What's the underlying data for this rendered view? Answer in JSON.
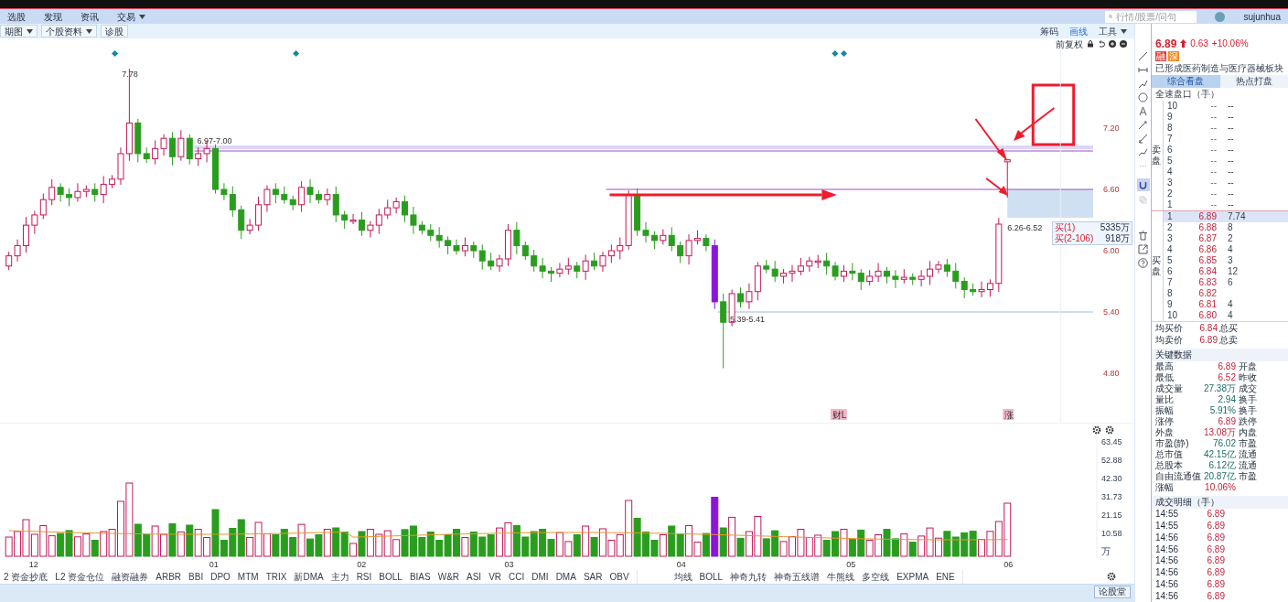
{
  "menu": [
    {
      "label": "选股",
      "dropdown": false
    },
    {
      "label": "发现",
      "dropdown": false
    },
    {
      "label": "资讯",
      "dropdown": false
    },
    {
      "label": "交易",
      "dropdown": true
    }
  ],
  "search": {
    "placeholder": "行情/股票/问句"
  },
  "user": "sujunhua",
  "toolbar_left": [
    {
      "label": "期图",
      "dropdown": true
    },
    {
      "label": "个股资料",
      "dropdown": true
    },
    {
      "label": "诊股",
      "dropdown": false
    }
  ],
  "toolbar_right": [
    {
      "label": "筹码",
      "selected": false,
      "dropdown": false
    },
    {
      "label": "画线",
      "selected": true,
      "dropdown": false
    },
    {
      "label": "工具",
      "selected": false,
      "dropdown": true
    }
  ],
  "adjust": "前复权",
  "chart": {
    "labels": [
      "7.78",
      "6.97-7.00",
      "6.26-6.52",
      "5.39-5.41"
    ],
    "price_ticks": [
      "7.20",
      "6.60",
      "6.00",
      "5.40",
      "4.80"
    ],
    "events": [
      "财L",
      "涨"
    ],
    "tooltip": [
      {
        "label": "买(1)",
        "value": "5335万"
      },
      {
        "label": "买(2-106)",
        "value": "918万"
      }
    ]
  },
  "volume": {
    "ticks": [
      "63.45",
      "52.88",
      "42.30",
      "31.73",
      "21.15",
      "10.58"
    ],
    "unit": "万"
  },
  "dates": [
    "12",
    "01",
    "02",
    "03",
    "04",
    "05",
    "06"
  ],
  "indicators": [
    "2 资金抄底",
    "L2 资金仓位",
    "融资融券",
    "ARBR",
    "BBI",
    "DPO",
    "MTM",
    "TRIX",
    "新DMA",
    "主力",
    "RSI",
    "BOLL",
    "BIAS",
    "W&R",
    "ASI",
    "VR",
    "CCI",
    "DMI",
    "DMA",
    "SAR",
    "OBV"
  ],
  "overlays": [
    "均线",
    "BOLL",
    "神奇九转",
    "神奇五线谱",
    "牛熊线",
    "多空线",
    "EXPMA",
    "ENE"
  ],
  "forum_button": "论股堂",
  "quote": {
    "price": "6.89",
    "change": "0.63",
    "percent": "+10.06%",
    "badges": [
      {
        "label": "融",
        "color": "#e8413c"
      },
      {
        "label": "深",
        "color": "#f08a24"
      }
    ],
    "note": "已形成医药制造与医疗器械板块"
  },
  "panel_tabs": [
    {
      "label": "综合看盘",
      "selected": true
    },
    {
      "label": "热点打盘",
      "selected": false
    }
  ],
  "orderbook": {
    "title": "全速盘口（手）",
    "sell_label": "卖盘",
    "buy_label": "买盘",
    "sell": [
      {
        "level": "10",
        "price": "--",
        "volume": "--"
      },
      {
        "level": "9",
        "price": "--",
        "volume": "--"
      },
      {
        "level": "8",
        "price": "--",
        "volume": "--"
      },
      {
        "level": "7",
        "price": "--",
        "volume": "--"
      },
      {
        "level": "6",
        "price": "--",
        "volume": "--"
      },
      {
        "level": "5",
        "price": "--",
        "volume": "--"
      },
      {
        "level": "4",
        "price": "--",
        "volume": "--"
      },
      {
        "level": "3",
        "price": "--",
        "volume": "--"
      },
      {
        "level": "2",
        "price": "--",
        "volume": "--"
      },
      {
        "level": "1",
        "price": "--",
        "volume": "--"
      }
    ],
    "buy": [
      {
        "level": "1",
        "price": "6.89",
        "volume": "7.74"
      },
      {
        "level": "2",
        "price": "6.88",
        "volume": "8"
      },
      {
        "level": "3",
        "price": "6.87",
        "volume": "2"
      },
      {
        "level": "4",
        "price": "6.86",
        "volume": "4"
      },
      {
        "level": "5",
        "price": "6.85",
        "volume": "3"
      },
      {
        "level": "6",
        "price": "6.84",
        "volume": "12"
      },
      {
        "level": "7",
        "price": "6.83",
        "volume": "6"
      },
      {
        "level": "8",
        "price": "6.82"
      },
      {
        "level": "9",
        "price": "6.81",
        "volume": "4"
      },
      {
        "level": "10",
        "price": "6.80",
        "volume": "4"
      }
    ]
  },
  "averages": [
    {
      "label": "均买价",
      "value": "6.84",
      "extra": "总买"
    },
    {
      "label": "均卖价",
      "value": "6.89",
      "extra": "总卖"
    }
  ],
  "key_data": {
    "title": "关键数据",
    "rows": [
      {
        "label": "最高",
        "value": "6.89",
        "extra": "开盘",
        "kind": "up"
      },
      {
        "label": "最低",
        "value": "6.52",
        "extra": "昨收",
        "kind": "up"
      },
      {
        "label": "成交量",
        "value": "27.38万",
        "extra": "成交",
        "kind": "flat"
      },
      {
        "label": "量比",
        "value": "2.94",
        "extra": "换手",
        "kind": "flat"
      },
      {
        "label": "振幅",
        "value": "5.91%",
        "extra": "换手",
        "kind": "flat"
      },
      {
        "label": "涨停",
        "value": "6.89",
        "extra": "跌停",
        "kind": "up"
      },
      {
        "label": "外盘",
        "value": "13.08万",
        "extra": "内盘",
        "kind": "up"
      },
      {
        "label": "市盈(静)",
        "value": "76.02",
        "extra": "市盈",
        "kind": "flat"
      },
      {
        "label": "总市值",
        "value": "42.15亿",
        "extra": "流通",
        "kind": "flat"
      },
      {
        "label": "总股本",
        "value": "6.12亿",
        "extra": "流通",
        "kind": "flat"
      },
      {
        "label": "自由流通值",
        "value": "20.87亿",
        "extra": "市盈",
        "kind": "flat"
      },
      {
        "label": "涨幅",
        "value": "10.06%",
        "extra": "",
        "kind": "up"
      }
    ]
  },
  "trades": {
    "title": "成交明细（手）",
    "rows": [
      {
        "time": "14:55",
        "price": "6.89"
      },
      {
        "time": "14:55",
        "price": "6.89"
      },
      {
        "time": "14:56",
        "price": "6.89"
      },
      {
        "time": "14:56",
        "price": "6.89"
      },
      {
        "time": "14:56",
        "price": "6.89"
      },
      {
        "time": "14:56",
        "price": "6.89"
      },
      {
        "time": "14:56",
        "price": "6.89"
      },
      {
        "time": "14:56",
        "price": "6.89"
      }
    ]
  }
}
